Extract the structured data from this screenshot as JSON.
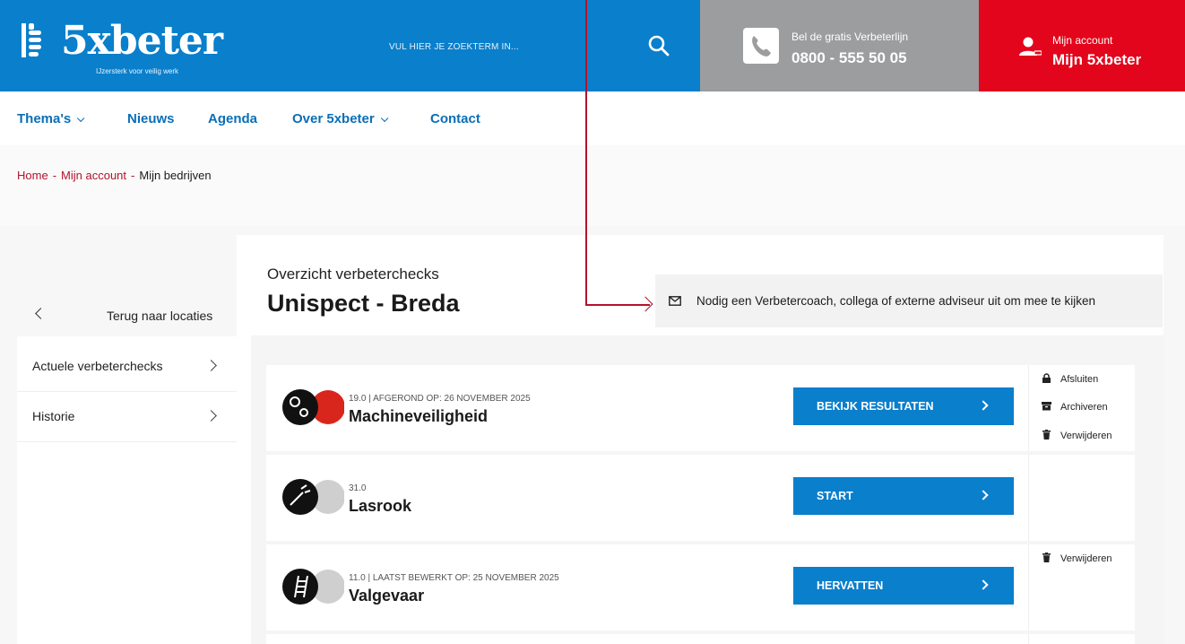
{
  "header": {
    "logo_text": "5xbeter",
    "logo_tagline": "IJzersterk voor veilig werk",
    "search_placeholder": "VUL HIER JE ZOEKTERM IN...",
    "phone_label": "Bel de gratis Verbeterlijn",
    "phone_number": "0800 - 555 50 05",
    "account_label": "Mijn account",
    "account_main": "Mijn 5xbeter"
  },
  "nav": {
    "items": [
      "Thema's",
      "Nieuws",
      "Agenda",
      "Over 5xbeter",
      "Contact"
    ]
  },
  "breadcrumb": {
    "home": "Home",
    "account": "Mijn account",
    "current": "Mijn bedrijven",
    "sep": "-"
  },
  "sidebar": {
    "back_label": "Terug naar locaties",
    "items": [
      "Actuele verbeterchecks",
      "Historie"
    ]
  },
  "main": {
    "subtitle": "Overzicht verbeterchecks",
    "title": "Unispect - Breda",
    "invite_text": "Nodig een Verbetercoach, collega of externe adviseur uit om mee te kijken"
  },
  "checks": [
    {
      "meta": "19.0 | AFGEROND OP: 26 NOVEMBER 2025",
      "title": "Machineveiligheid",
      "button": "BEKIJK RESULTATEN",
      "status_color": "#d9261c",
      "actions": [
        "Afsluiten",
        "Archiveren",
        "Verwijderen"
      ]
    },
    {
      "meta": "31.0",
      "title": "Lasrook",
      "button": "START",
      "status_color": "#cfcfcf",
      "actions": []
    },
    {
      "meta": "11.0 | LAATST BEWERKT OP: 25 NOVEMBER 2025",
      "title": "Valgevaar",
      "button": "HERVATTEN",
      "status_color": "#cfcfcf",
      "actions": [
        "Verwijderen"
      ]
    }
  ],
  "colors": {
    "brand_blue": "#0a7fcb",
    "phone_grey": "#9b9d9f",
    "account_red": "#e3051b",
    "link_red": "#b3132b"
  }
}
